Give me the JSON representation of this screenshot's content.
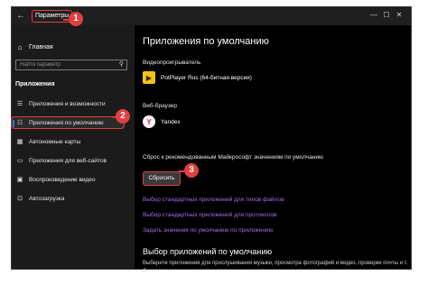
{
  "window": {
    "title": "Параметры",
    "back_icon": "back-arrow-icon",
    "controls": [
      "—",
      "☐",
      "✕"
    ]
  },
  "sidebar": {
    "home": {
      "label": "Главная",
      "icon": "home-icon"
    },
    "search": {
      "placeholder": "Найти параметр",
      "icon": "search-icon"
    },
    "section_title": "Приложения",
    "items": [
      {
        "label": "Приложения и возможности",
        "icon": "apps-list-icon",
        "active": false
      },
      {
        "label": "Приложения по умолчанию",
        "icon": "default-apps-icon",
        "active": true
      },
      {
        "label": "Автономные карты",
        "icon": "map-icon",
        "active": false
      },
      {
        "label": "Приложения для веб-сайтов",
        "icon": "web-apps-icon",
        "active": false
      },
      {
        "label": "Воспроизведение видео",
        "icon": "video-icon",
        "active": false
      },
      {
        "label": "Автозагрузка",
        "icon": "startup-icon",
        "active": false
      }
    ]
  },
  "main": {
    "title": "Приложения по умолчанию",
    "video_player": {
      "label": "Видеопроигрыватель",
      "app": "PotPlayer Rus (64-битная версия)"
    },
    "web_browser": {
      "label": "Веб-браузер",
      "app": "Yandex"
    },
    "reset": {
      "description": "Сброс к рекомендованным Майкрософт значениям по умолчанию",
      "button": "Сбросить"
    },
    "links": [
      "Выбор стандартных приложений для типов файлов",
      "Выбор стандартных приложений для протоколов",
      "Задать значения по умолчанию по приложению"
    ],
    "choose_section": {
      "title": "Выбор приложений по умолчанию",
      "description": "Выберите приложения для прослушивания музыки, просмотра фотографий и видео, проверки почты и т. д."
    }
  },
  "annotations": {
    "badge_1": "1",
    "badge_2": "2",
    "badge_3": "3",
    "color": "#e04040"
  }
}
